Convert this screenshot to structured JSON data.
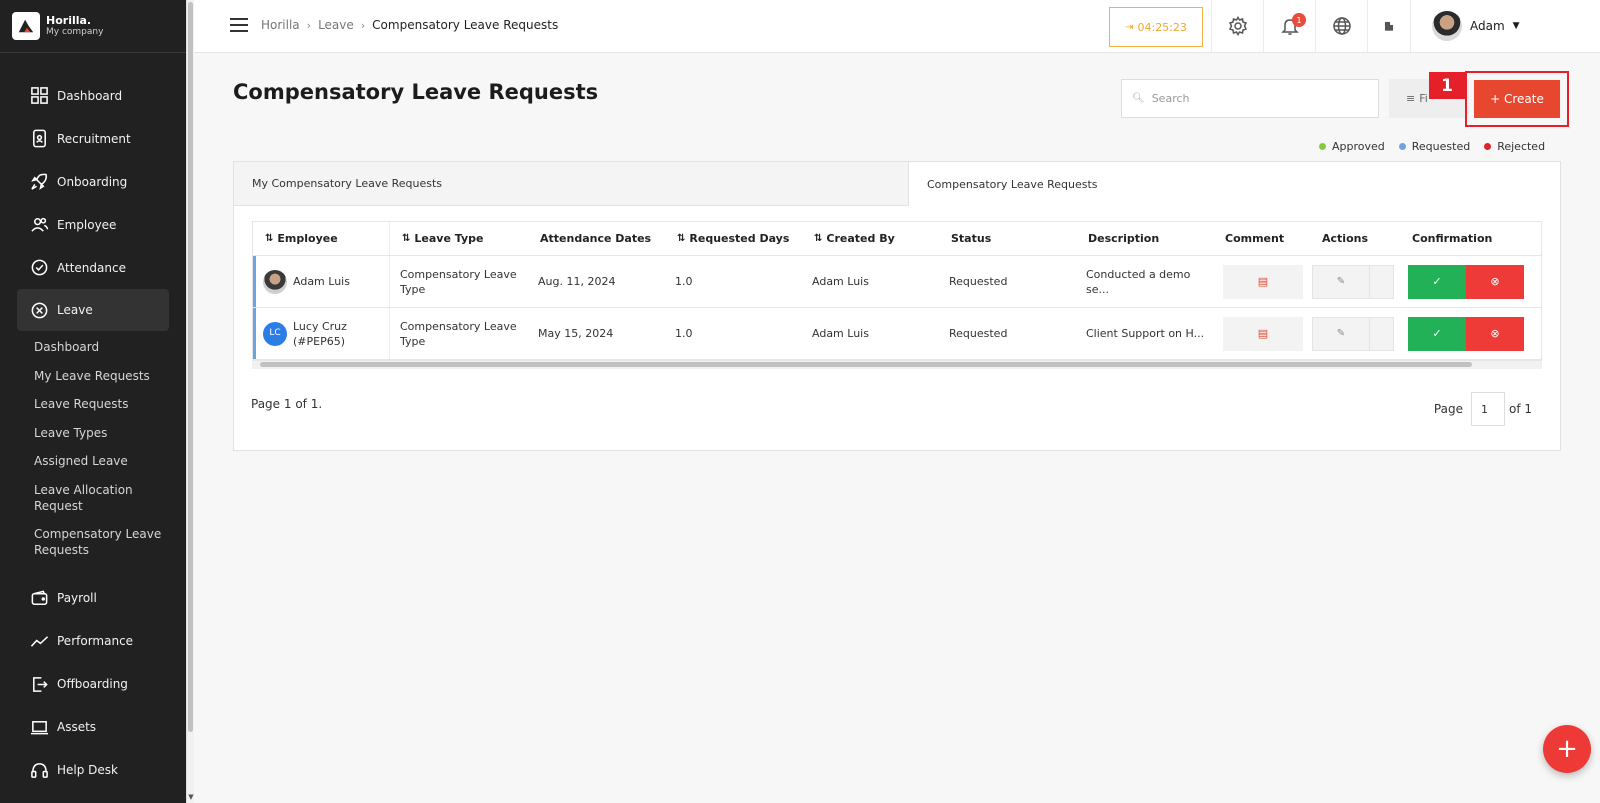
{
  "brand": {
    "name": "Horilla.",
    "company": "My company"
  },
  "sidebar": {
    "items": [
      {
        "label": "Dashboard",
        "icon": "dashboard-icon"
      },
      {
        "label": "Recruitment",
        "icon": "recruitment-icon"
      },
      {
        "label": "Onboarding",
        "icon": "rocket-icon"
      },
      {
        "label": "Employee",
        "icon": "users-icon"
      },
      {
        "label": "Attendance",
        "icon": "check-circle-icon"
      },
      {
        "label": "Leave",
        "icon": "leave-icon"
      },
      {
        "label": "Payroll",
        "icon": "wallet-icon"
      },
      {
        "label": "Performance",
        "icon": "chart-line-icon"
      },
      {
        "label": "Offboarding",
        "icon": "exit-icon"
      },
      {
        "label": "Assets",
        "icon": "laptop-icon"
      },
      {
        "label": "Help Desk",
        "icon": "headset-icon"
      }
    ],
    "leave_subitems": [
      "Dashboard",
      "My Leave Requests",
      "Leave Requests",
      "Leave Types",
      "Assigned Leave",
      "Leave Allocation Request",
      "Compensatory Leave Requests"
    ]
  },
  "header": {
    "breadcrumb": [
      "Horilla",
      "Leave",
      "Compensatory Leave Requests"
    ],
    "timer": "04:25:23",
    "notification_count": "1",
    "user_name": "Adam"
  },
  "page": {
    "title": "Compensatory Leave Requests",
    "search_placeholder": "Search",
    "filter_label": "Fi",
    "create_label": "+ Create",
    "step_marker": "1"
  },
  "legend": [
    {
      "label": "Approved",
      "color": "#8cc63f"
    },
    {
      "label": "Requested",
      "color": "#6ea3e0"
    },
    {
      "label": "Rejected",
      "color": "#e5202a"
    }
  ],
  "tabs": [
    {
      "label": "My Compensatory Leave Requests"
    },
    {
      "label": "Compensatory Leave Requests"
    }
  ],
  "table": {
    "columns": [
      "Employee",
      "Leave Type",
      "Attendance Dates",
      "Requested Days",
      "Created By",
      "Status",
      "Description",
      "Comment",
      "Actions",
      "Confirmation"
    ],
    "rows": [
      {
        "employee": "Adam Luis",
        "initials": "",
        "leave_type": "Compensatory Leave Type",
        "attendance_dates": "Aug. 11, 2024",
        "requested_days": "1.0",
        "created_by": "Adam Luis",
        "status": "Requested",
        "description": "Conducted a demo se..."
      },
      {
        "employee": "Lucy Cruz (#PEP65)",
        "initials": "LC",
        "leave_type": "Compensatory Leave Type",
        "attendance_dates": "May 15, 2024",
        "requested_days": "1.0",
        "created_by": "Adam Luis",
        "status": "Requested",
        "description": "Client Support on H..."
      }
    ]
  },
  "pagination": {
    "info": "Page 1 of 1.",
    "page_label": "Page",
    "current": "1",
    "of_label": "of 1"
  },
  "fab_label": "+"
}
